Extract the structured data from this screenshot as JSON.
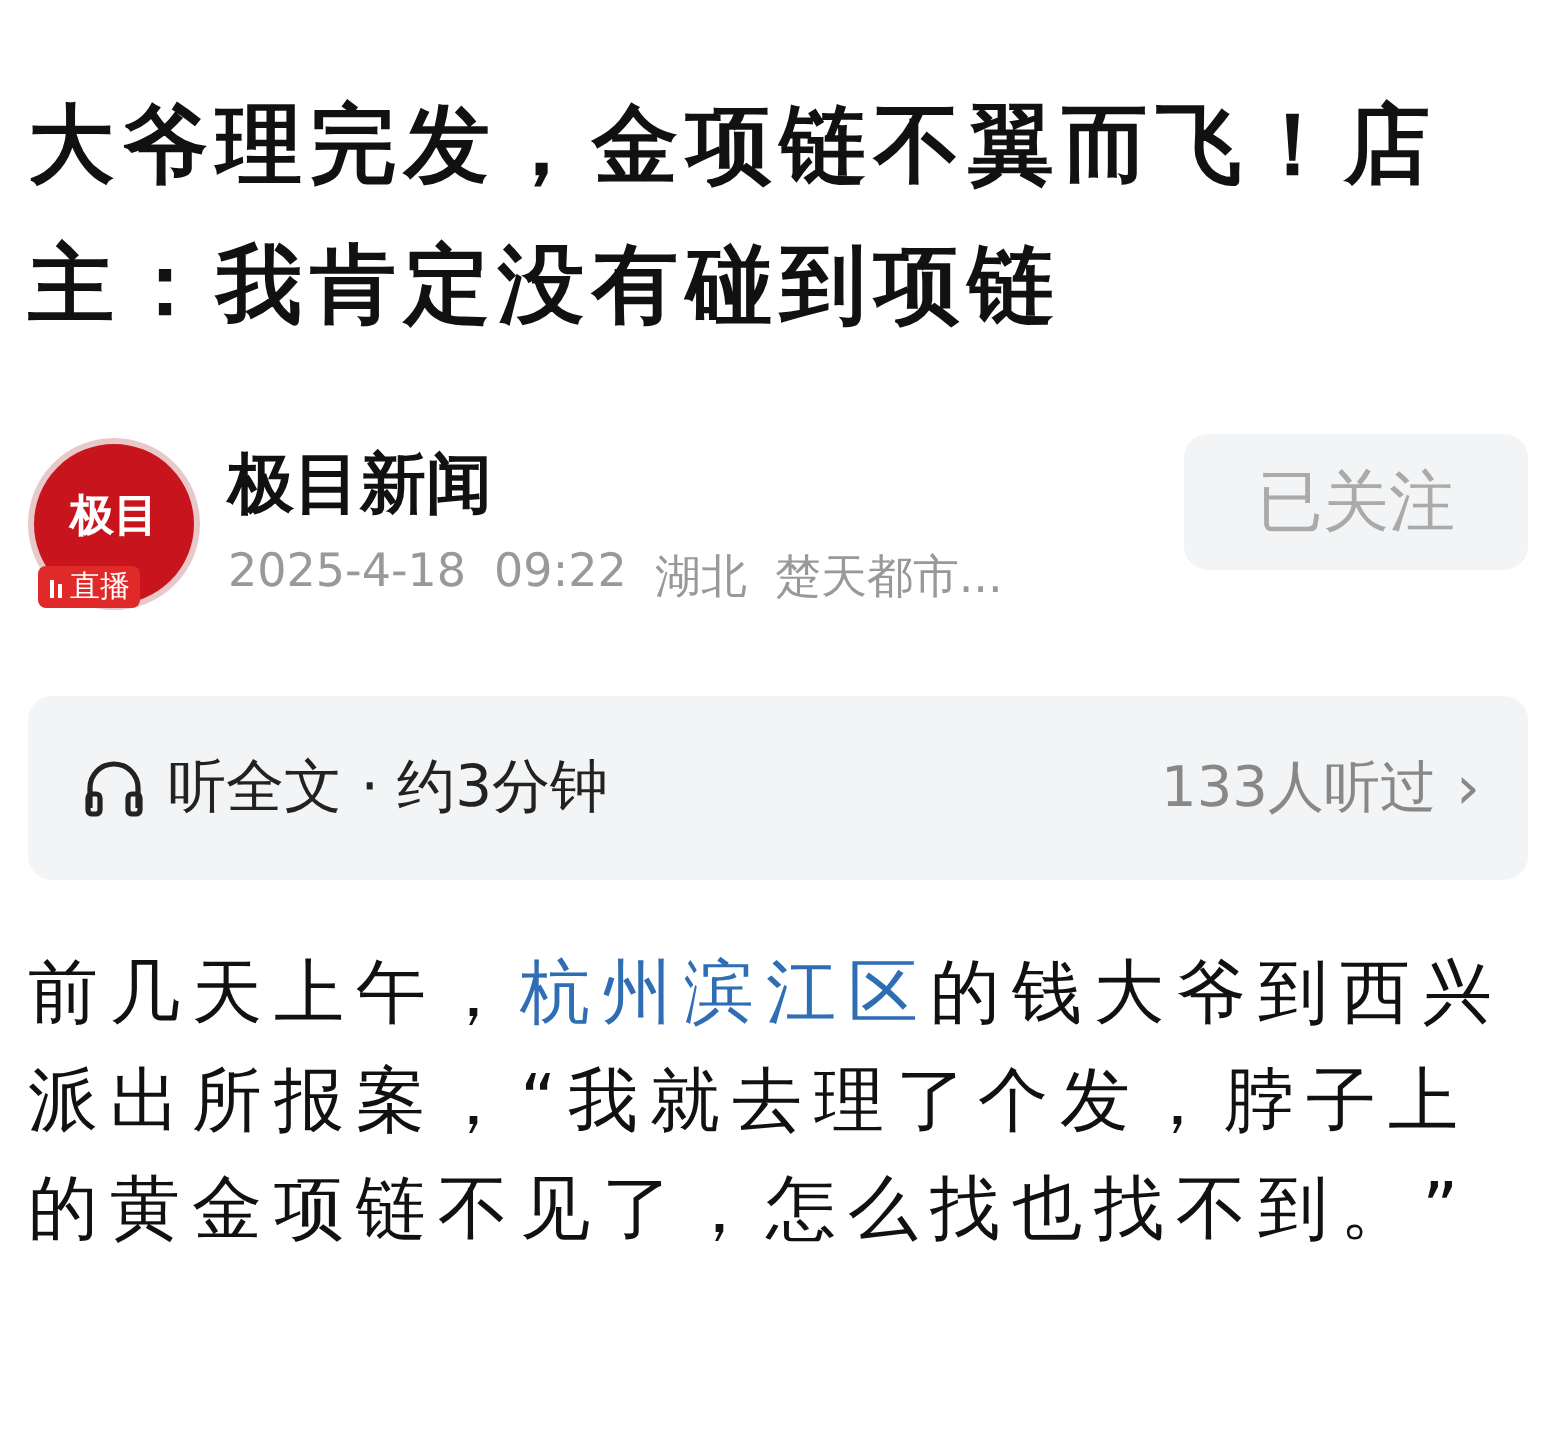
{
  "headline": "大爷理完发，金项链不翼而飞！店主：我肯定没有碰到项链",
  "source": {
    "logo_text": "极目",
    "live_badge": "直播",
    "name": "极目新闻",
    "date": "2025-4-18",
    "time": "09:22",
    "region": "湖北",
    "publisher": "楚天都市...",
    "follow": {
      "label": "已关注",
      "followed": true
    }
  },
  "listen": {
    "label": "听全文 · 约3分钟",
    "listeners": "133人听过",
    "chevron": "›"
  },
  "body": [
    {
      "kind": "plain",
      "text": "前几天上午，"
    },
    {
      "kind": "link",
      "text": "杭州滨江区"
    },
    {
      "kind": "plain",
      "text": "的钱大爷到西兴派出所报案，“我就去理了个发，脖子上的黄金项链不见了，怎么找也找不到。”"
    }
  ]
}
